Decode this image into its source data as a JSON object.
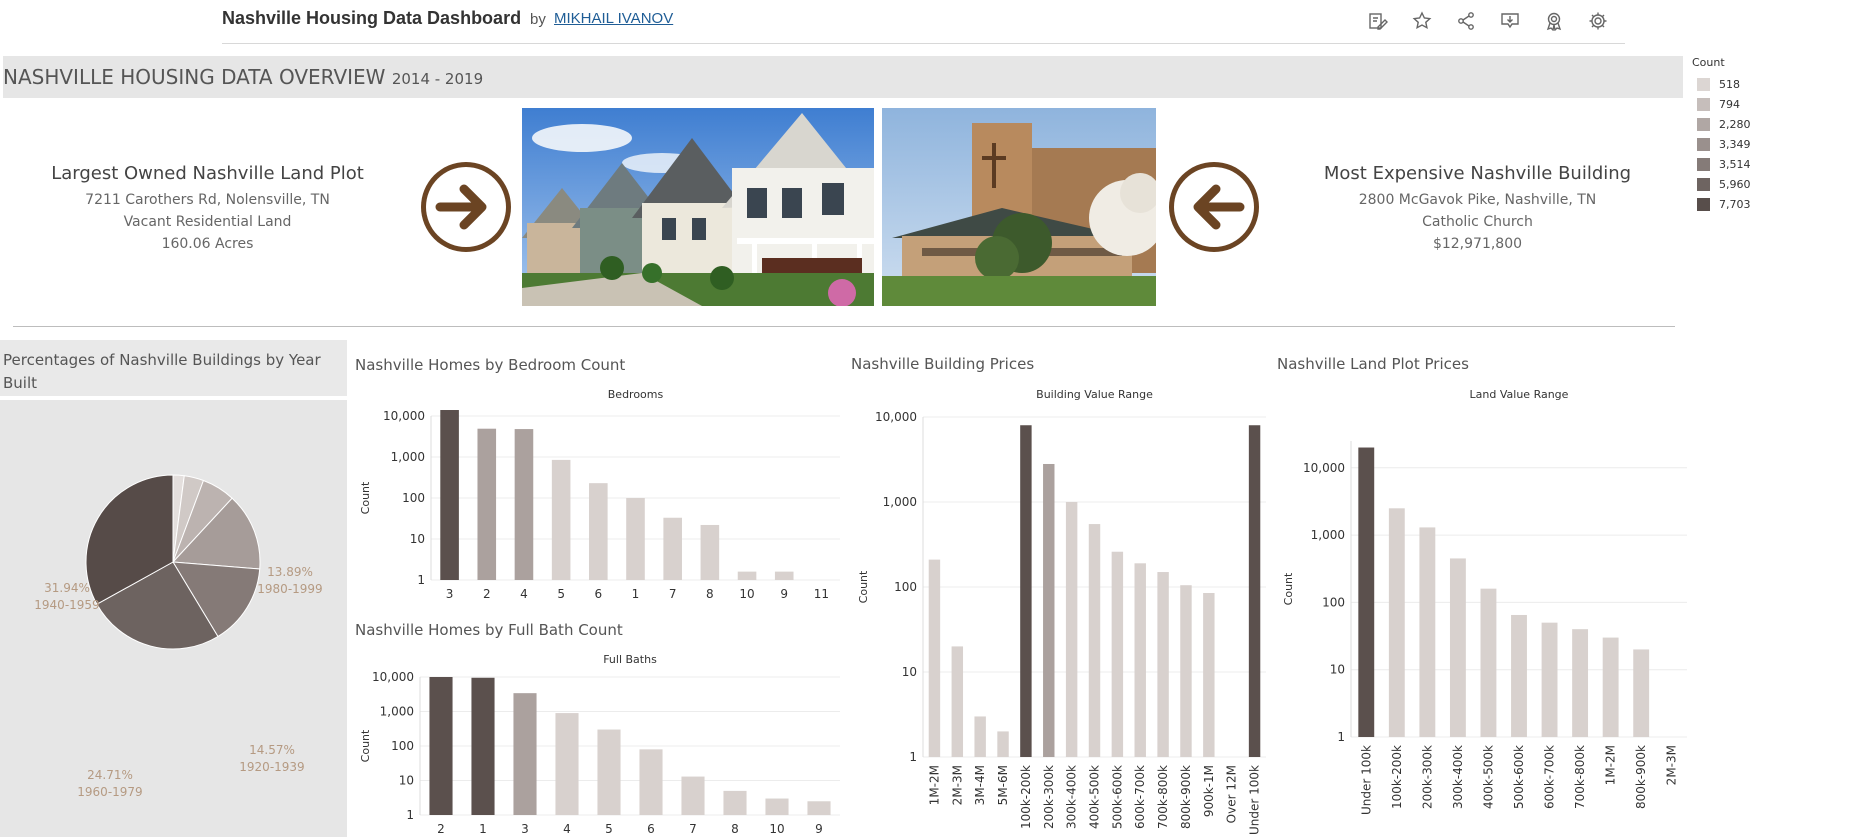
{
  "header": {
    "title": "Nashville Housing Data Dashboard",
    "by": "by",
    "author": "MIKHAIL IVANOV",
    "toolbar": [
      {
        "name": "edit-icon"
      },
      {
        "name": "favorite-star-icon"
      },
      {
        "name": "share-icon"
      },
      {
        "name": "download-icon"
      },
      {
        "name": "badge-icon"
      },
      {
        "name": "settings-gear-icon"
      }
    ]
  },
  "overview": {
    "title": "NASHVILLE HOUSING DATA OVERVIEW",
    "years": "2014 - 2019"
  },
  "legend": {
    "title": "Count",
    "items": [
      {
        "label": "518",
        "color": "#dcd6d3"
      },
      {
        "label": "794",
        "color": "#c6bebb"
      },
      {
        "label": "2,280",
        "color": "#b0a7a4"
      },
      {
        "label": "3,349",
        "color": "#9a908d"
      },
      {
        "label": "3,514",
        "color": "#857b78"
      },
      {
        "label": "5,960",
        "color": "#6e6461"
      },
      {
        "label": "7,703",
        "color": "#584e4b"
      }
    ]
  },
  "largest_plot": {
    "title": "Largest Owned Nashville Land Plot",
    "address": "7211 Carothers Rd, Nolensville, TN",
    "use": "Vacant Residential Land",
    "size": "160.06 Acres"
  },
  "most_expensive": {
    "title": "Most Expensive Nashville Building",
    "address": "2800 McGavok Pike, Nashville, TN",
    "use": "Catholic Church",
    "value": "$12,971,800"
  },
  "colors": {
    "accent_brown": "#6b4423",
    "bar_dark": "#5b504d",
    "bar_mid": "#aba19e",
    "bar_light": "#d8d1ce",
    "label_tan": "#b59a82"
  },
  "pie": {
    "title": "Percentages of Nashville Buildings by Year Built"
  },
  "charts": {
    "bedrooms": {
      "title": "Nashville Homes by Bedroom Count"
    },
    "fullbath": {
      "title": "Nashville Homes by Full Bath Count"
    },
    "building": {
      "title": "Nashville Building Prices"
    },
    "land": {
      "title": "Nashville Land Plot Prices"
    }
  },
  "chart_data": [
    {
      "id": "pie",
      "type": "pie",
      "title": "Percentages of Nashville Buildings by Year Built",
      "slices": [
        {
          "label": "",
          "value": 2.0,
          "color": "#e4dfdd",
          "pct": "",
          "range": ""
        },
        {
          "label": "",
          "value": 3.5,
          "color": "#d0c9c6",
          "pct": "",
          "range": ""
        },
        {
          "label": "",
          "value": 6.0,
          "color": "#bcb3b0",
          "pct": "",
          "range": ""
        },
        {
          "label": "1980-1999",
          "value": 13.89,
          "color": "#a69c99",
          "pct": "13.89%",
          "range": "1980-1999"
        },
        {
          "label": "1920-1939",
          "value": 14.57,
          "color": "#857a77",
          "pct": "14.57%",
          "range": "1920-1939"
        },
        {
          "label": "1960-1979",
          "value": 24.71,
          "color": "#6d6360",
          "pct": "24.71%",
          "range": "1960-1979"
        },
        {
          "label": "1940-1959",
          "value": 31.94,
          "color": "#564b48",
          "pct": "31.94%",
          "range": "1940-1959"
        }
      ]
    },
    {
      "id": "bedrooms",
      "type": "bar",
      "title": "Bedrooms",
      "ylabel": "Count",
      "scale": "log",
      "ylim": [
        1,
        10000
      ],
      "yticks": [
        {
          "v": 1,
          "t": "1"
        },
        {
          "v": 10,
          "t": "10"
        },
        {
          "v": 100,
          "t": "100"
        },
        {
          "v": 1000,
          "t": "1,000"
        },
        {
          "v": 10000,
          "t": "10,000"
        }
      ],
      "categories": [
        "3",
        "2",
        "4",
        "5",
        "6",
        "1",
        "7",
        "8",
        "10",
        "9",
        "11"
      ],
      "values": [
        14000,
        4900,
        4800,
        850,
        230,
        100,
        33,
        22,
        1.6,
        1.6,
        1
      ],
      "colors": [
        "#5b504d",
        "#aba19e",
        "#aba19e",
        "#d8d1ce",
        "#d8d1ce",
        "#d8d1ce",
        "#d8d1ce",
        "#d8d1ce",
        "#d8d1ce",
        "#d8d1ce",
        "#d8d1ce"
      ]
    },
    {
      "id": "fullbath",
      "type": "bar",
      "title": "Full Baths",
      "ylabel": "Count",
      "scale": "log",
      "ylim": [
        1,
        10000
      ],
      "yticks": [
        {
          "v": 1,
          "t": "1"
        },
        {
          "v": 10,
          "t": "10"
        },
        {
          "v": 100,
          "t": "100"
        },
        {
          "v": 1000,
          "t": "1,000"
        },
        {
          "v": 10000,
          "t": "10,000"
        }
      ],
      "categories": [
        "2",
        "1",
        "3",
        "4",
        "5",
        "6",
        "7",
        "8",
        "10",
        "9"
      ],
      "values": [
        10000,
        9500,
        3400,
        900,
        300,
        80,
        13,
        5,
        3,
        2.5
      ],
      "colors": [
        "#5b504d",
        "#5b504d",
        "#aba19e",
        "#d8d1ce",
        "#d8d1ce",
        "#d8d1ce",
        "#d8d1ce",
        "#d8d1ce",
        "#d8d1ce",
        "#d8d1ce"
      ]
    },
    {
      "id": "building",
      "type": "bar",
      "title": "Building Value Range",
      "ylabel": "Count",
      "scale": "log",
      "ylim": [
        1,
        10000
      ],
      "yticks": [
        {
          "v": 1,
          "t": "1"
        },
        {
          "v": 10,
          "t": "10"
        },
        {
          "v": 100,
          "t": "100"
        },
        {
          "v": 1000,
          "t": "1,000"
        },
        {
          "v": 10000,
          "t": "10,000"
        }
      ],
      "categories": [
        "1M-2M",
        "2M-3M",
        "3M-4M",
        "5M-6M",
        "100k-200k",
        "200k-300k",
        "300k-400k",
        "400k-500k",
        "500k-600k",
        "600k-700k",
        "700k-800k",
        "800k-900k",
        "900k-1M",
        "Over 12M",
        "Under 100k"
      ],
      "values": [
        210,
        20,
        3,
        2,
        8000,
        2800,
        1000,
        550,
        260,
        190,
        150,
        105,
        85,
        1,
        8000
      ],
      "colors": [
        "#d8d1ce",
        "#d8d1ce",
        "#d8d1ce",
        "#d8d1ce",
        "#5b504d",
        "#aba19e",
        "#d8d1ce",
        "#d8d1ce",
        "#d8d1ce",
        "#d8d1ce",
        "#d8d1ce",
        "#d8d1ce",
        "#d8d1ce",
        "#d8d1ce",
        "#5b504d"
      ]
    },
    {
      "id": "land",
      "type": "bar",
      "title": "Land Value Range",
      "ylabel": "Count",
      "scale": "log",
      "ylim": [
        1,
        25000
      ],
      "yticks": [
        {
          "v": 1,
          "t": "1"
        },
        {
          "v": 10,
          "t": "10"
        },
        {
          "v": 100,
          "t": "100"
        },
        {
          "v": 1000,
          "t": "1,000"
        },
        {
          "v": 10000,
          "t": "10,000"
        }
      ],
      "categories": [
        "Under 100k",
        "100k-200k",
        "200k-300k",
        "300k-400k",
        "400k-500k",
        "500k-600k",
        "600k-700k",
        "700k-800k",
        "1M-2M",
        "800k-900k",
        "2M-3M"
      ],
      "values": [
        20000,
        2500,
        1300,
        450,
        160,
        65,
        50,
        40,
        30,
        20,
        1
      ],
      "colors": [
        "#5b504d",
        "#d8d1ce",
        "#d8d1ce",
        "#d8d1ce",
        "#d8d1ce",
        "#d8d1ce",
        "#d8d1ce",
        "#d8d1ce",
        "#d8d1ce",
        "#d8d1ce",
        "#d8d1ce"
      ]
    }
  ]
}
